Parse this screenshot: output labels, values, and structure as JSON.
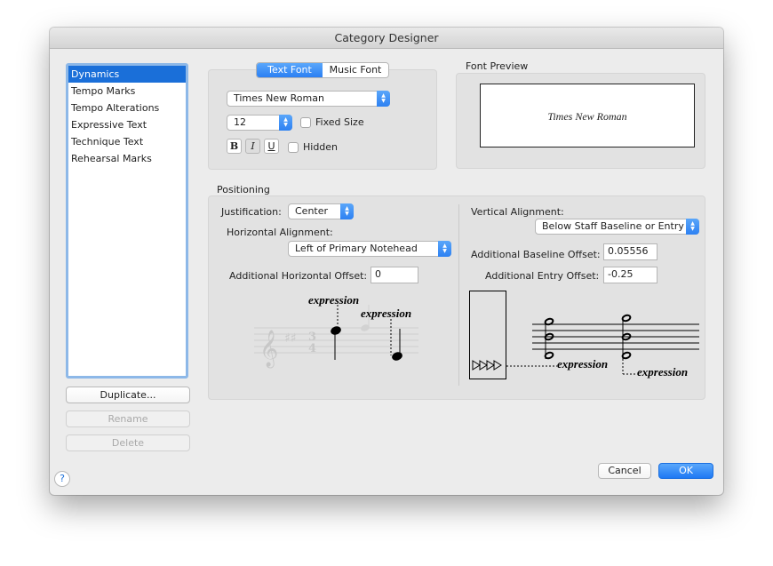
{
  "window": {
    "title": "Category Designer"
  },
  "categories": [
    {
      "label": "Dynamics",
      "selected": true
    },
    {
      "label": "Tempo Marks"
    },
    {
      "label": "Tempo Alterations"
    },
    {
      "label": "Expressive Text"
    },
    {
      "label": "Technique Text"
    },
    {
      "label": "Rehearsal Marks"
    }
  ],
  "list_buttons": {
    "duplicate": "Duplicate...",
    "rename": "Rename",
    "delete": "Delete"
  },
  "font": {
    "tabs": [
      {
        "label": "Text Font",
        "active": true
      },
      {
        "label": "Music Font",
        "active": false
      }
    ],
    "family": "Times New Roman",
    "size": "12",
    "fixed_size_label": "Fixed Size",
    "bold": "B",
    "italic": "I",
    "underline": "U",
    "hidden_label": "Hidden"
  },
  "preview": {
    "heading": "Font Preview",
    "sample": "Times New Roman"
  },
  "positioning": {
    "heading": "Positioning",
    "justification_label": "Justification:",
    "justification_value": "Center",
    "horizontal_alignment_label": "Horizontal Alignment:",
    "horizontal_alignment_value": "Left of Primary Notehead",
    "additional_horizontal_offset_label": "Additional Horizontal Offset:",
    "additional_horizontal_offset_value": "0",
    "vertical_alignment_label": "Vertical Alignment:",
    "vertical_alignment_value": "Below Staff Baseline or Entry",
    "additional_baseline_offset_label": "Additional Baseline Offset:",
    "additional_baseline_offset_value": "0.05556",
    "additional_entry_offset_label": "Additional Entry Offset:",
    "additional_entry_offset_value": "-0.25",
    "example_text": "expression"
  },
  "dialog_buttons": {
    "cancel": "Cancel",
    "ok": "OK",
    "help": "?"
  },
  "colors": {
    "accent": "#1a6fd9",
    "list_focus": "#8db8e8"
  }
}
